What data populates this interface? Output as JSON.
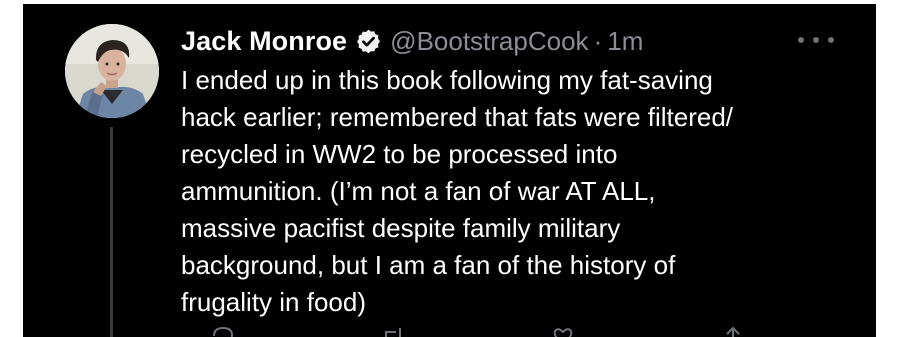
{
  "tweet": {
    "display_name": "Jack Monroe",
    "handle": "@BootstrapCook",
    "separator": "·",
    "time_ago": "1m",
    "text_lines": [
      "I ended up in this book following my fat-saving",
      "hack earlier; remembered that fats were filtered/",
      "recycled in WW2 to be processed into",
      "ammunition. (I’m not a fan of war AT ALL,",
      "massive pacifist despite family military",
      "background, but I am a fan of the history of",
      "frugality in food)"
    ]
  },
  "icons": {
    "verified": "verified-badge-icon",
    "more": "more-options-icon",
    "reply": "reply-icon",
    "retweet": "retweet-icon",
    "like": "like-icon",
    "share": "share-icon"
  },
  "colors": {
    "background": "#000000",
    "primary_text": "#ffffff",
    "secondary_text": "#8b8f94",
    "thread_line": "#3a3a3a"
  }
}
